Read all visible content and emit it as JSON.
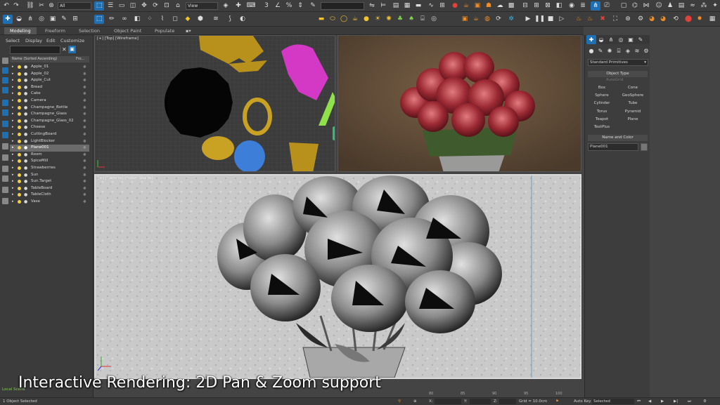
{
  "toolbar": {
    "selection_filter": "All",
    "view_dropdown": "View"
  },
  "ribbon": {
    "tabs": [
      "Modeling",
      "Freeform",
      "Selection",
      "Object Paint",
      "Populate"
    ]
  },
  "explorer": {
    "menu": [
      "Select",
      "Display",
      "Edit",
      "Customize"
    ],
    "column_header": "Name (Sorted Ascending)",
    "column_header2": "Fro...",
    "items": [
      "Apple_01",
      "Apple_02",
      "Apple_Cut",
      "Bread",
      "Cake",
      "Camera",
      "Champagne_Bottle",
      "Champagne_Glass",
      "Champagne_Glass_02",
      "Cheese",
      "CuttingBoard",
      "LightBlocker",
      "Plane001",
      "Room",
      "SpiceMill",
      "Strawberries",
      "Sun",
      "Sun.Target",
      "TableBoard",
      "TableCloth",
      "Vase"
    ],
    "selected_index": 12
  },
  "viewports": {
    "top_label": "[+] [Top] [Wireframe]",
    "main_label": "[+] [Camera] [Active Shade]"
  },
  "command_panel": {
    "category": "Standard Primitives",
    "object_type_title": "Object Type",
    "autogrid": "AutoGrid",
    "buttons": [
      "Box",
      "Cone",
      "Sphere",
      "GeoSphere",
      "Cylinder",
      "Tube",
      "Torus",
      "Pyramid",
      "Teapot",
      "Plane",
      "TextPlus"
    ],
    "name_color_title": "Name and Color",
    "object_name": "Plane001"
  },
  "status": {
    "selection": "1 Object Selected",
    "local_scene": "Local Scene",
    "x_label": "X:",
    "y_label": "Y:",
    "z_label": "Z:",
    "grid": "Grid = 10.0cm",
    "auto_key": "Auto Key",
    "selected_dropdown": "Selected",
    "timeline_ticks": [
      "80",
      "85",
      "90",
      "95",
      "100"
    ]
  },
  "caption": "Interactive Rendering: 2D Pan & Zoom support",
  "colors": {
    "accent_blue": "#1f6fb3",
    "selection_row": "#6b6b6b",
    "bulb": "#f4d03f"
  }
}
